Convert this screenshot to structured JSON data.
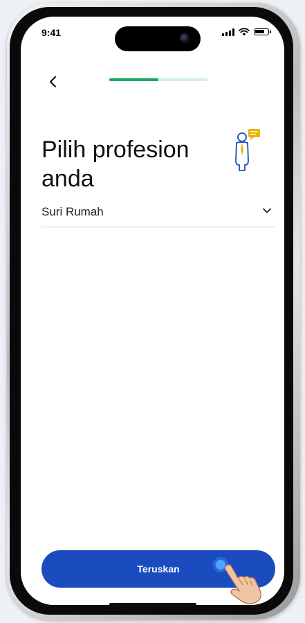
{
  "status_bar": {
    "time": "9:41"
  },
  "header": {
    "onboarding_progress": 0.5
  },
  "page": {
    "title": "Pilih profesion anda"
  },
  "profession_select": {
    "value": "Suri Rumah"
  },
  "footer": {
    "continue_label": "Teruskan"
  },
  "colors": {
    "primary_button": "#1a4cc0",
    "progress_active": "#1aa861",
    "progress_track": "#d5f0e2",
    "icon_accent": "#e8b400",
    "icon_outline": "#1a4cc0"
  }
}
